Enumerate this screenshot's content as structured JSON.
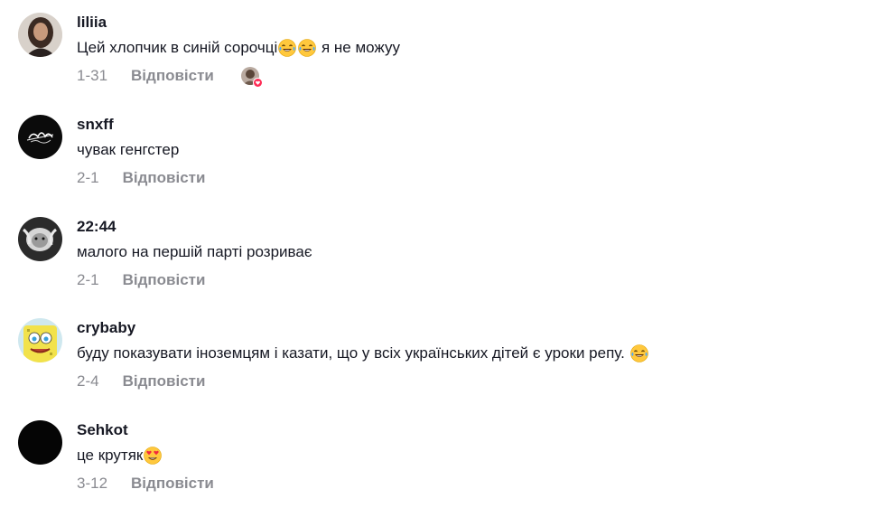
{
  "colors": {
    "text": "#161823",
    "secondary": "#8a8b91",
    "heart": "#fe2c55",
    "background": "#ffffff"
  },
  "comments": [
    {
      "username": "liliia",
      "text_before": "Цей хлопчик в синій сорочці",
      "emojis_mid": [
        "face-with-tears-of-joy",
        "face-with-tears-of-joy"
      ],
      "text_after": " я не можуу",
      "date": "1-31",
      "reply_label": "Відповісти",
      "creator_liked_icon": "heart-icon",
      "avatar_icon": "avatar-photo"
    },
    {
      "username": "snxff",
      "text": "чувак генгстер",
      "date": "2-1",
      "reply_label": "Відповісти",
      "avatar_icon": "avatar-logo"
    },
    {
      "username": "22:44",
      "text": "малого на першій парті розриває",
      "date": "2-1",
      "reply_label": "Відповісти",
      "avatar_icon": "avatar-photo"
    },
    {
      "username": "crybaby",
      "text": "буду показувати іноземцям і казати, що у всіх українських дітей є уроки репу. ",
      "emoji_end": "face-with-tears-of-joy",
      "date": "2-4",
      "reply_label": "Відповісти",
      "avatar_icon": "avatar-cartoon"
    },
    {
      "username": "Sehkot",
      "text": "це крутяк",
      "emoji_end": "smiling-face-with-heart-eyes",
      "date": "3-12",
      "reply_label": "Відповісти",
      "avatar_icon": "avatar-black"
    }
  ]
}
